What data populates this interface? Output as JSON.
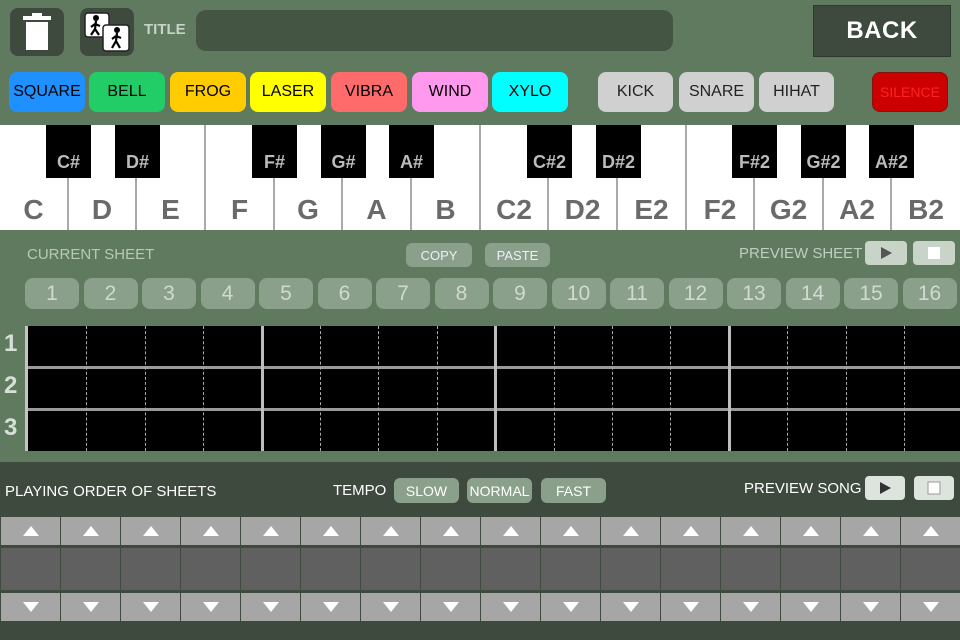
{
  "header": {
    "title_label": "TITLE",
    "title_value": "",
    "back_label": "BACK",
    "trash_icon": "trash-icon",
    "walk_icon": "walking-people-icon"
  },
  "instruments": [
    {
      "label": "SQUARE",
      "color": "#1e90ff",
      "text_color": "#000000"
    },
    {
      "label": "BELL",
      "color": "#22cc66",
      "text_color": "#000000"
    },
    {
      "label": "FROG",
      "color": "#ffcc00",
      "text_color": "#000000"
    },
    {
      "label": "LASER",
      "color": "#ffff00",
      "text_color": "#000000"
    },
    {
      "label": "VIBRA",
      "color": "#ff6b6b",
      "text_color": "#000000"
    },
    {
      "label": "WIND",
      "color": "#ff99ee",
      "text_color": "#000000"
    },
    {
      "label": "XYLO",
      "color": "#00ffff",
      "text_color": "#000000"
    }
  ],
  "drums": [
    {
      "label": "KICK"
    },
    {
      "label": "SNARE"
    },
    {
      "label": "HIHAT"
    }
  ],
  "silence_label": "SILENCE",
  "keyboard": {
    "white_keys": [
      "C",
      "D",
      "E",
      "F",
      "G",
      "A",
      "B",
      "C2",
      "D2",
      "E2",
      "F2",
      "G2",
      "A2",
      "B2"
    ],
    "black_keys": [
      "C#",
      "D#",
      "F#",
      "G#",
      "A#",
      "C#2",
      "D#2",
      "F#2",
      "G#2",
      "A#2"
    ]
  },
  "current_sheet": {
    "label": "CURRENT SHEET",
    "copy_label": "COPY",
    "paste_label": "PASTE",
    "preview_label": "PREVIEW SHEET",
    "sheet_numbers": [
      "1",
      "2",
      "3",
      "4",
      "5",
      "6",
      "7",
      "8",
      "9",
      "10",
      "11",
      "12",
      "13",
      "14",
      "15",
      "16"
    ],
    "row_labels": [
      "1",
      "2",
      "3"
    ]
  },
  "order": {
    "label": "PLAYING ORDER OF SHEETS",
    "tempo_label": "TEMPO",
    "tempo_options": [
      "SLOW",
      "NORMAL",
      "FAST"
    ],
    "preview_label": "PREVIEW SONG"
  }
}
